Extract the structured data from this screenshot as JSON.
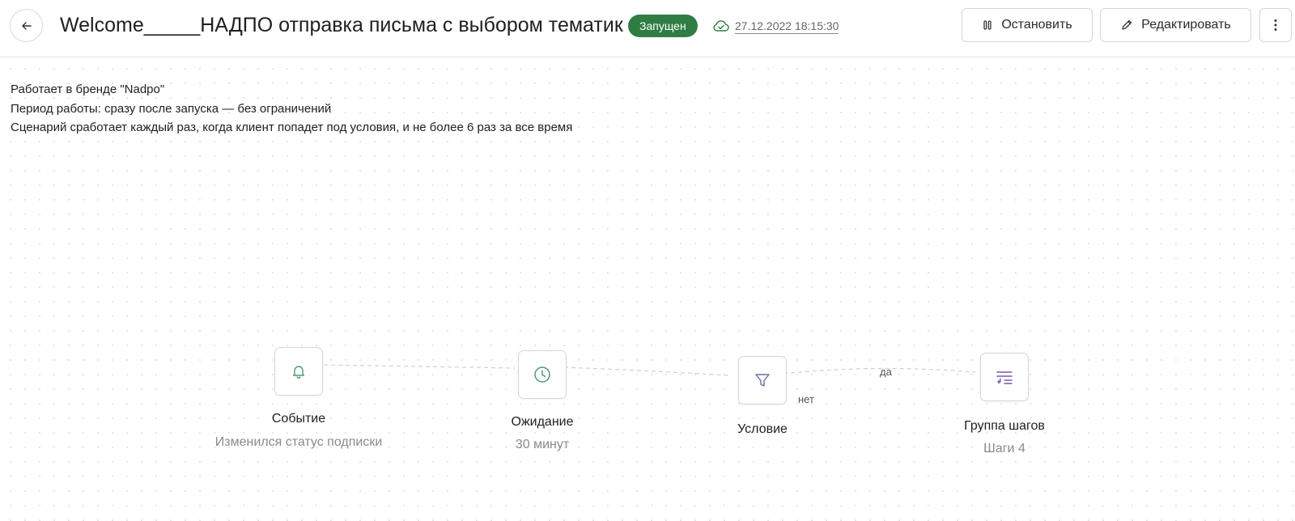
{
  "header": {
    "back_icon": "arrow-left-icon",
    "title": "Welcome_____НАДПО отправка письма с выбором тематик",
    "status_badge": "Запущен",
    "status_color": "#2f7d45",
    "saved_icon": "cloud-check-icon",
    "saved_at": "27.12.2022 18:15:30",
    "buttons": {
      "stop": {
        "label": "Остановить",
        "icon": "pause-icon"
      },
      "edit": {
        "label": "Редактировать",
        "icon": "pencil-icon"
      },
      "more": {
        "icon": "more-vertical-icon"
      }
    }
  },
  "info": {
    "brand": "Работает в бренде \"Nadpo\"",
    "period": "Период работы: сразу после запуска — без ограничений",
    "frequency": "Сценарий сработает каждый раз, когда клиент попадет под условия, и не более 6 раз за все время"
  },
  "flow": {
    "nodes": [
      {
        "title": "Событие",
        "subtitle": "Изменился статус подписки",
        "icon": "bell-icon",
        "icon_color": "#4e9a72"
      },
      {
        "title": "Ожидание",
        "subtitle": "30 минут",
        "icon": "clock-icon",
        "icon_color": "#4e9a72"
      },
      {
        "title": "Условие",
        "subtitle": "",
        "icon": "filter-icon",
        "icon_color": "#6a6fa8"
      },
      {
        "title": "Группа шагов",
        "subtitle": "Шаги 4",
        "icon": "step-group-icon",
        "icon_color": "#7a5aa8"
      }
    ],
    "branches": {
      "yes": "да",
      "no": "нет"
    }
  }
}
